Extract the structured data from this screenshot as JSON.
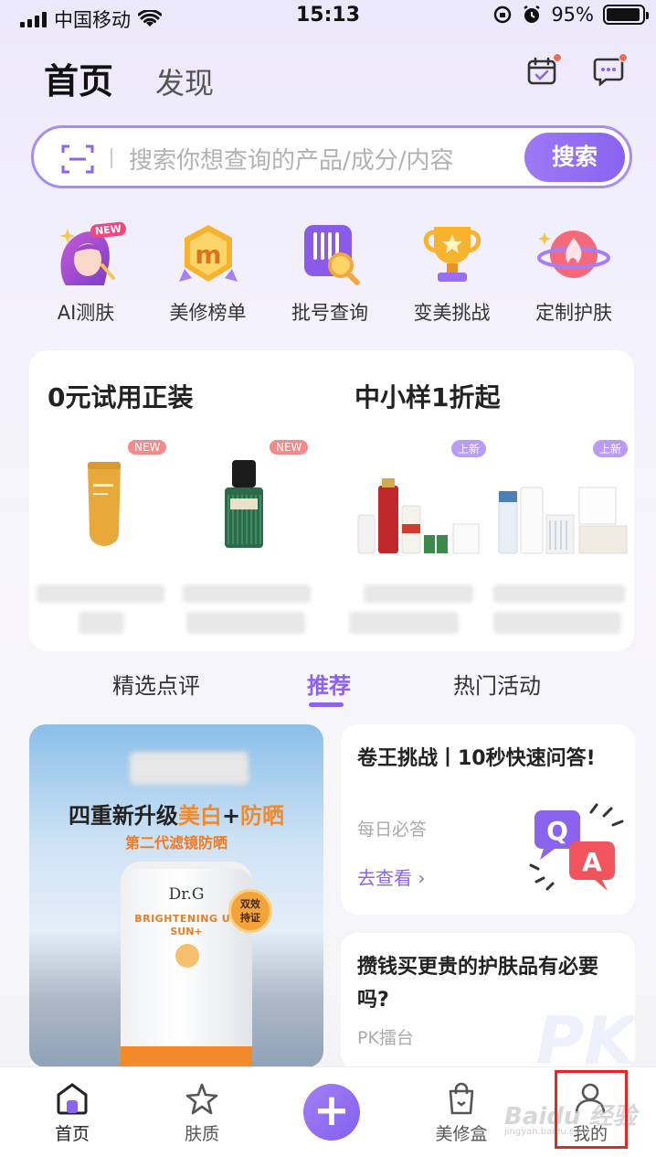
{
  "status_bar": {
    "carrier": "中国移动",
    "time": "15:13",
    "battery": "95%",
    "battery_level": 0.95
  },
  "header": {
    "tab_home": "首页",
    "tab_discover": "发现",
    "calendar_icon": "calendar-check-icon",
    "message_icon": "message-icon"
  },
  "search": {
    "placeholder": "搜索你想查询的产品/成分/内容",
    "button": "搜索"
  },
  "entries": [
    {
      "label": "AI测肤",
      "icon": "ai-skin-icon",
      "badge": "NEW"
    },
    {
      "label": "美修榜单",
      "icon": "ranking-medal-icon"
    },
    {
      "label": "批号查询",
      "icon": "batch-search-icon"
    },
    {
      "label": "变美挑战",
      "icon": "trophy-icon"
    },
    {
      "label": "定制护肤",
      "icon": "custom-care-icon"
    }
  ],
  "trial": {
    "left_title": "0元试用正装",
    "right_title": "中小样1折起",
    "tag_new": "NEW",
    "tag_shang": "上新"
  },
  "content_tabs": {
    "tab1": "精选点评",
    "tab2": "推荐",
    "tab3": "热门活动"
  },
  "ad": {
    "headline_part1": "四重新升级",
    "headline_part2": "美白",
    "headline_part3": "+",
    "headline_part4": "防晒",
    "subline": "第二代滤镜防晒",
    "brand": "Dr.G",
    "product_name": "BRIGHTENING UP",
    "product_sub": "SUN+",
    "seal": "双效\n持证"
  },
  "feed": {
    "card1_title": "卷王挑战丨10秒快速问答!",
    "card1_sub": "每日必答",
    "card1_link": "去查看 ›",
    "card2_title": "攒钱买更贵的护肤品有必要吗?",
    "card2_sub": "PK擂台",
    "card2_bg": "PK"
  },
  "bottom_nav": {
    "home": "首页",
    "skin": "肤质",
    "add": "+",
    "box": "美修盒",
    "me": "我的"
  },
  "watermark": {
    "main": "Baidu 经验",
    "sub": "jingyan.baidu.com"
  },
  "colors": {
    "accent": "#8a63ef",
    "highlight": "#e8261f"
  }
}
